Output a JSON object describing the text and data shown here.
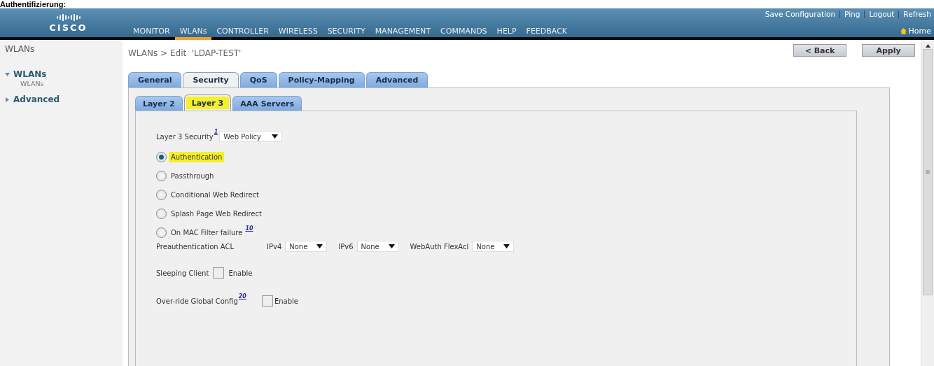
{
  "caption": "Authentifizierung:",
  "header": {
    "logo": "CISCO",
    "top_links": [
      "Save Configuration",
      "Ping",
      "Logout",
      "Refresh"
    ],
    "menu": [
      {
        "label": "MONITOR",
        "selected": false
      },
      {
        "label": "WLANs",
        "selected": true
      },
      {
        "label": "CONTROLLER",
        "selected": false
      },
      {
        "label": "WIRELESS",
        "selected": false
      },
      {
        "label": "SECURITY",
        "selected": false
      },
      {
        "label": "MANAGEMENT",
        "selected": false
      },
      {
        "label": "COMMANDS",
        "selected": false
      },
      {
        "label": "HELP",
        "selected": false
      },
      {
        "label": "FEEDBACK",
        "selected": false
      }
    ],
    "home": "Home"
  },
  "sidebar": {
    "title": "WLANs",
    "items": [
      {
        "label": "WLANs",
        "expanded": true,
        "children": [
          {
            "label": "WLANs"
          }
        ]
      },
      {
        "label": "Advanced",
        "expanded": false
      }
    ]
  },
  "breadcrumb": "WLANs > Edit  'LDAP-TEST'",
  "buttons": [
    "< Back",
    "Apply"
  ],
  "tabs": [
    {
      "label": "General",
      "selected": false
    },
    {
      "label": "Security",
      "selected": true
    },
    {
      "label": "QoS",
      "selected": false
    },
    {
      "label": "Policy-Mapping",
      "selected": false
    },
    {
      "label": "Advanced",
      "selected": false
    }
  ],
  "subtabs": [
    {
      "label": "Layer 2",
      "selected": false,
      "highlighted": false
    },
    {
      "label": "Layer 3",
      "selected": true,
      "highlighted": true
    },
    {
      "label": "AAA Servers",
      "selected": false,
      "highlighted": false
    }
  ],
  "form": {
    "layer3_security": {
      "label": "Layer 3 Security",
      "note": "1",
      "value": "Web Policy"
    },
    "options": [
      {
        "label": "Authentication",
        "selected": true,
        "highlighted": true
      },
      {
        "label": "Passthrough",
        "selected": false,
        "highlighted": false
      },
      {
        "label": "Conditional Web Redirect",
        "selected": false,
        "highlighted": false
      },
      {
        "label": "Splash Page Web Redirect",
        "selected": false,
        "highlighted": false
      },
      {
        "label": "On MAC Filter failure",
        "note": "10",
        "selected": false,
        "highlighted": false
      }
    ],
    "preauth": {
      "label": "Preauthentication ACL",
      "selects": [
        {
          "label": "IPv4",
          "value": "None"
        },
        {
          "label": "IPv6",
          "value": "None"
        },
        {
          "label": "WebAuth FlexAcl",
          "value": "None"
        }
      ]
    },
    "sleeping_client": {
      "label": "Sleeping Client",
      "checked": false,
      "option": "Enable"
    },
    "override": {
      "label": "Over-ride Global Config",
      "note": "20",
      "checked": false,
      "option": "Enable"
    }
  }
}
